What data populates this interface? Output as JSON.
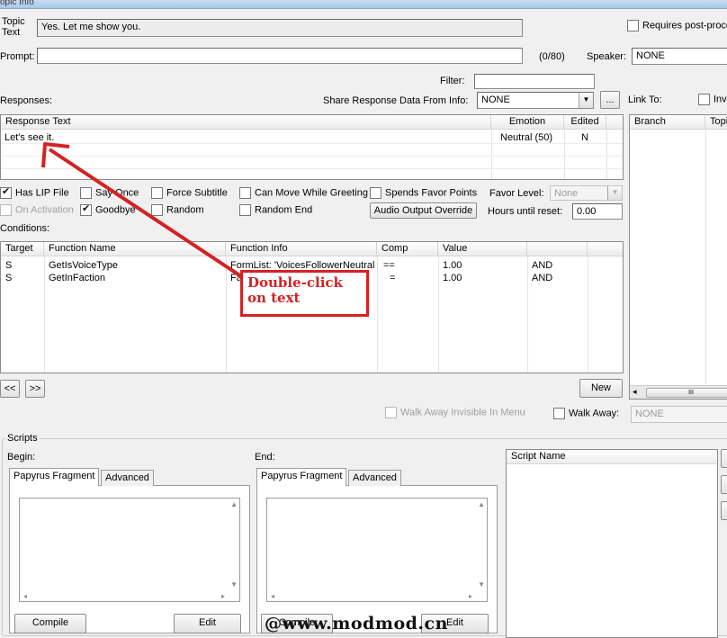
{
  "window": {
    "title": "opic Info"
  },
  "topic": {
    "label": "Topic\nText",
    "value": "Yes. Let me show you.",
    "requires_post_process": "Requires post-proce"
  },
  "prompt": {
    "label": "Prompt:",
    "value": "",
    "counter": "(0/80)",
    "speaker_label": "Speaker:",
    "speaker_value": "NONE"
  },
  "filter": {
    "label": "Filter:",
    "value": ""
  },
  "responses": {
    "label": "Responses:",
    "share_label": "Share Response Data From Info:",
    "share_value": "NONE",
    "ellipsis": "...",
    "columns": [
      "Response Text",
      "Emotion",
      "Edited"
    ],
    "rows": [
      {
        "text": "Let's see it.",
        "emotion": "Neutral (50)",
        "edited": "N"
      }
    ]
  },
  "link_to": {
    "label": "Link To:",
    "inv": "Inv",
    "columns": [
      "Branch",
      "Topi"
    ]
  },
  "options": {
    "has_lip_file": "Has LIP File",
    "say_once": "Say Once",
    "force_subtitle": "Force Subtitle",
    "can_move_while_greeting": "Can Move While Greeting",
    "spends_favor_points": "Spends Favor Points",
    "favor_level_label": "Favor Level:",
    "favor_level_value": "None",
    "on_activation": "On Activation",
    "goodbye": "Goodbye",
    "random": "Random",
    "random_end": "Random End",
    "audio_output_override": "Audio Output Override",
    "hours_until_reset_label": "Hours until reset:",
    "hours_until_reset_value": "0.00"
  },
  "conditions": {
    "label": "Conditions:",
    "columns": [
      "Target",
      "Function Name",
      "Function Info",
      "Comp",
      "Value",
      ""
    ],
    "rows": [
      {
        "target": "S",
        "function": "GetIsVoiceType",
        "info": "FormList: 'VoicesFollowerNeutral'",
        "comp": "==",
        "value": "1.00",
        "logic": "AND"
      },
      {
        "target": "S",
        "function": "GetInFaction",
        "info": "Faction: ...",
        "comp": "=",
        "value": "1.00",
        "logic": "AND"
      }
    ],
    "prev": "<<",
    "next": ">>",
    "new": "New"
  },
  "walk_away": {
    "invisible_label": "Walk Away Invisible In Menu",
    "label": "Walk Away:",
    "value": "NONE"
  },
  "scripts": {
    "label": "Scripts",
    "begin_label": "Begin:",
    "end_label": "End:",
    "tab_fragment": "Papyrus Fragment",
    "tab_advanced": "Advanced",
    "compile": "Compile",
    "edit": "Edit",
    "script_name_header": "Script Name"
  },
  "annotation": {
    "text": "Double-click on text",
    "color": "#d42222"
  },
  "watermark": {
    "text": "@www.modmod.cn"
  }
}
